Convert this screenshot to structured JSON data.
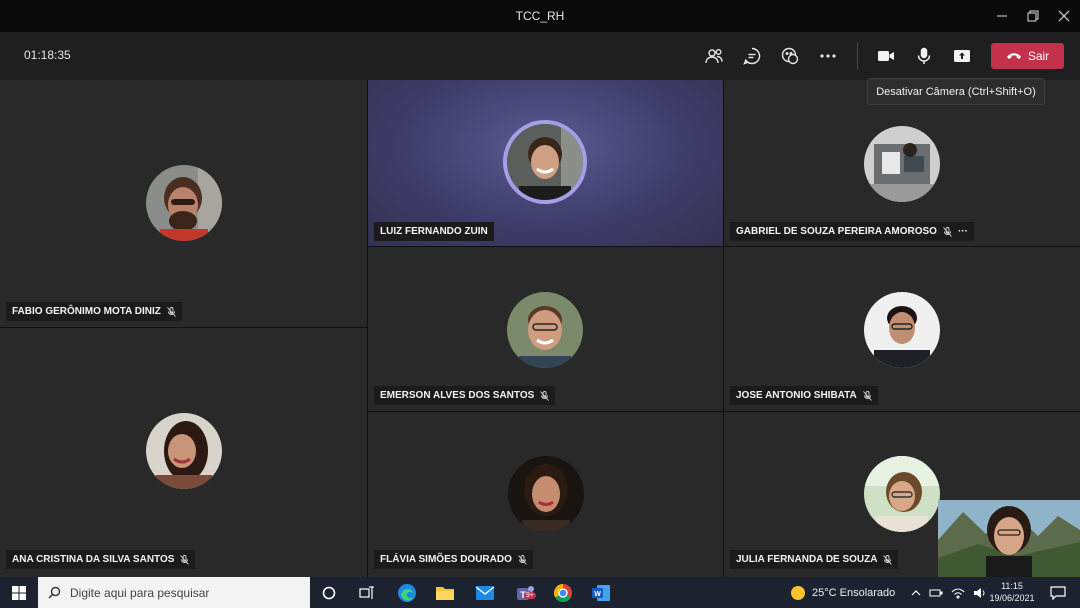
{
  "window": {
    "title": "TCC_RH"
  },
  "toolbar": {
    "timer": "01:18:35",
    "leave_label": "Sair",
    "tooltip": "Desativar Câmera (Ctrl+Shift+O)"
  },
  "participants": [
    {
      "name": "FABIO GERÔNIMO MOTA DINIZ",
      "muted": true
    },
    {
      "name": "LUIZ FERNANDO ZUIN",
      "muted": false,
      "speaking": true
    },
    {
      "name": "GABRIEL DE SOUZA PEREIRA AMOROSO",
      "muted": true,
      "more": "···"
    },
    {
      "name": "EMERSON ALVES DOS SANTOS",
      "muted": true
    },
    {
      "name": "JOSE ANTONIO SHIBATA",
      "muted": true
    },
    {
      "name": "ANA CRISTINA DA SILVA SANTOS",
      "muted": true
    },
    {
      "name": "FLÁVIA SIMÕES DOURADO",
      "muted": true
    },
    {
      "name": "JULIA FERNANDA DE SOUZA",
      "muted": true
    }
  ],
  "taskbar": {
    "search_placeholder": "Digite aqui para pesquisar",
    "teams_badge": "9+",
    "weather": "25°C  Ensolarado",
    "time": "11:15",
    "date": "19/06/2021"
  },
  "colors": {
    "leave": "#c4314b",
    "speaking_ring": "#a3a0e8",
    "tile": "#292929"
  }
}
